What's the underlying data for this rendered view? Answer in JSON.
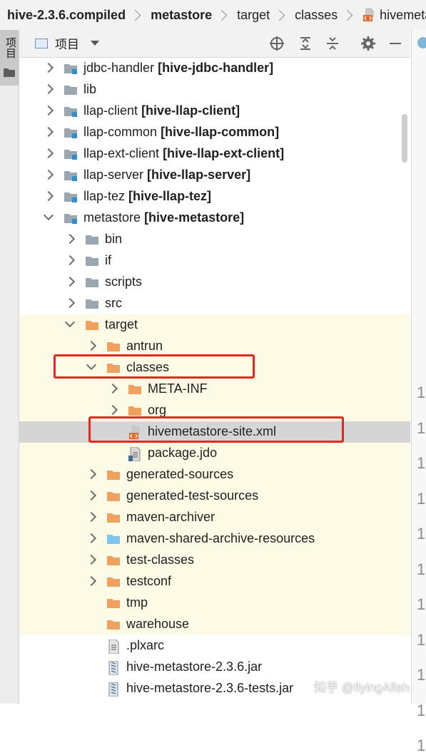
{
  "breadcrumb": [
    "hive-2.3.6.compiled",
    "metastore",
    "target",
    "classes",
    "hivemetas"
  ],
  "side_tab": {
    "label": "项目"
  },
  "toolbar": {
    "title": "项目"
  },
  "tree": [
    {
      "name": "jdbc-handler",
      "module": "[hive-jdbc-handler]",
      "icon": "module-folder-icon",
      "level": 0,
      "arrow": "right"
    },
    {
      "name": "lib",
      "module": "",
      "icon": "folder-gray-icon",
      "level": 0,
      "arrow": "right"
    },
    {
      "name": "llap-client",
      "module": "[hive-llap-client]",
      "icon": "module-folder-icon",
      "level": 0,
      "arrow": "right"
    },
    {
      "name": "llap-common",
      "module": "[hive-llap-common]",
      "icon": "module-folder-icon",
      "level": 0,
      "arrow": "right"
    },
    {
      "name": "llap-ext-client",
      "module": "[hive-llap-ext-client]",
      "icon": "module-folder-icon",
      "level": 0,
      "arrow": "right"
    },
    {
      "name": "llap-server",
      "module": "[hive-llap-server]",
      "icon": "module-folder-icon",
      "level": 0,
      "arrow": "right"
    },
    {
      "name": "llap-tez",
      "module": "[hive-llap-tez]",
      "icon": "module-folder-icon",
      "level": 0,
      "arrow": "right"
    },
    {
      "name": "metastore",
      "module": "[hive-metastore]",
      "icon": "module-folder-icon",
      "level": 0,
      "arrow": "down"
    },
    {
      "name": "bin",
      "module": "",
      "icon": "folder-gray-icon",
      "level": 1,
      "arrow": "right"
    },
    {
      "name": "if",
      "module": "",
      "icon": "folder-gray-icon",
      "level": 1,
      "arrow": "right"
    },
    {
      "name": "scripts",
      "module": "",
      "icon": "folder-gray-icon",
      "level": 1,
      "arrow": "right"
    },
    {
      "name": "src",
      "module": "",
      "icon": "folder-gray-icon",
      "level": 1,
      "arrow": "right"
    },
    {
      "name": "target",
      "module": "",
      "icon": "folder-orange-icon",
      "level": 1,
      "arrow": "down",
      "highlight": "yellow"
    },
    {
      "name": "antrun",
      "module": "",
      "icon": "folder-orange-icon",
      "level": 2,
      "arrow": "right",
      "highlight": "yellow"
    },
    {
      "name": "classes",
      "module": "",
      "icon": "folder-orange-icon",
      "level": 2,
      "arrow": "down",
      "highlight": "yellow"
    },
    {
      "name": "META-INF",
      "module": "",
      "icon": "folder-orange-icon",
      "level": 3,
      "arrow": "right",
      "highlight": "yellow"
    },
    {
      "name": "org",
      "module": "",
      "icon": "folder-orange-icon",
      "level": 3,
      "arrow": "right",
      "highlight": "yellow"
    },
    {
      "name": "hivemetastore-site.xml",
      "module": "",
      "icon": "xml-file-icon",
      "level": 3,
      "arrow": "none",
      "highlight": "selected"
    },
    {
      "name": "package.jdo",
      "module": "",
      "icon": "file-icon",
      "level": 3,
      "arrow": "none",
      "highlight": "yellow"
    },
    {
      "name": "generated-sources",
      "module": "",
      "icon": "folder-orange-icon",
      "level": 2,
      "arrow": "right",
      "highlight": "yellow"
    },
    {
      "name": "generated-test-sources",
      "module": "",
      "icon": "folder-orange-icon",
      "level": 2,
      "arrow": "right",
      "highlight": "yellow"
    },
    {
      "name": "maven-archiver",
      "module": "",
      "icon": "folder-orange-icon",
      "level": 2,
      "arrow": "right",
      "highlight": "yellow"
    },
    {
      "name": "maven-shared-archive-resources",
      "module": "",
      "icon": "folder-blue-icon",
      "level": 2,
      "arrow": "right",
      "highlight": "yellow"
    },
    {
      "name": "test-classes",
      "module": "",
      "icon": "folder-orange-icon",
      "level": 2,
      "arrow": "right",
      "highlight": "yellow"
    },
    {
      "name": "testconf",
      "module": "",
      "icon": "folder-orange-icon",
      "level": 2,
      "arrow": "right",
      "highlight": "yellow"
    },
    {
      "name": "tmp",
      "module": "",
      "icon": "folder-orange-icon",
      "level": 2,
      "arrow": "none",
      "highlight": "yellow"
    },
    {
      "name": "warehouse",
      "module": "",
      "icon": "folder-orange-icon",
      "level": 2,
      "arrow": "none",
      "highlight": "yellow"
    },
    {
      "name": ".plxarc",
      "module": "",
      "icon": "text-file-icon",
      "level": 2,
      "arrow": "none"
    },
    {
      "name": "hive-metastore-2.3.6.jar",
      "module": "",
      "icon": "jar-icon",
      "level": 2,
      "arrow": "none"
    },
    {
      "name": "hive-metastore-2.3.6-tests.jar",
      "module": "",
      "icon": "jar-icon",
      "level": 2,
      "arrow": "none"
    }
  ],
  "gutter_numbers": [
    "1",
    "1",
    "1",
    "1",
    "1",
    "1",
    "1",
    "1",
    "1",
    "1",
    "1"
  ],
  "watermark": "知乎 @flyingAfish",
  "colors": {
    "accent": "#e8261b",
    "yellow_row": "#fdfbe6",
    "selected_row": "#d5d5d5",
    "folder_orange": "#f0a160",
    "folder_gray": "#9aa7b0",
    "folder_blue": "#7fc4ec"
  }
}
